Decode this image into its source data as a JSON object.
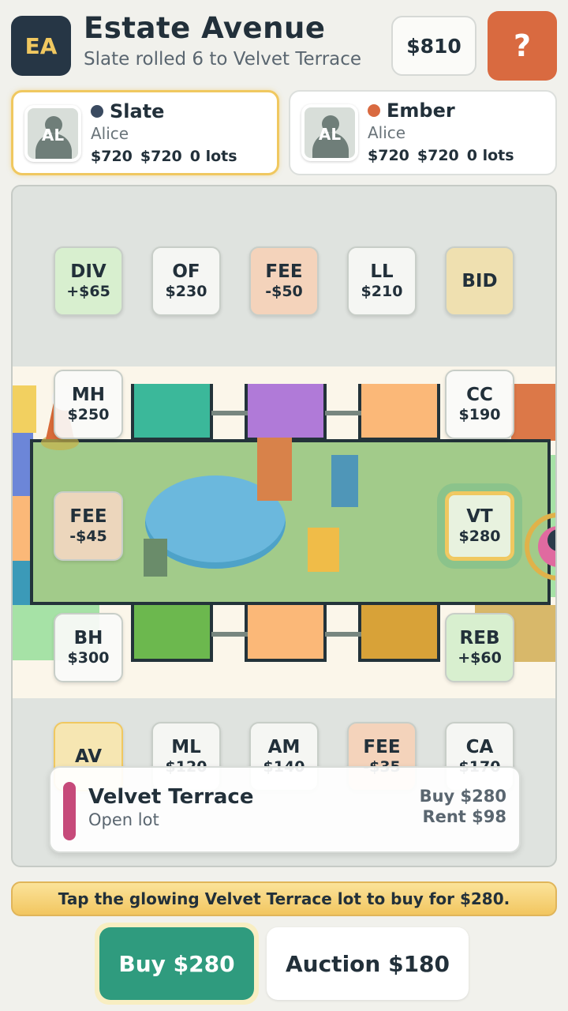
{
  "header": {
    "logo": "EA",
    "title": "Estate Avenue",
    "subtitle": "Slate rolled 6 to Velvet Terrace",
    "cash": "$810",
    "help": "?"
  },
  "players": [
    {
      "name": "Slate",
      "dot_color": "#3a4a60",
      "avatar": "AL",
      "owner": "Alice",
      "cash": "$720",
      "worth": "$720",
      "lots": "0 lots",
      "active": true
    },
    {
      "name": "Ember",
      "dot_color": "#d96a40",
      "avatar": "AL",
      "owner": "Alice",
      "cash": "$720",
      "worth": "$720",
      "lots": "0 lots",
      "active": false
    }
  ],
  "tiles": {
    "top_row": [
      {
        "code": "DIV",
        "val": "+$65",
        "color": "#d8efcf"
      },
      {
        "code": "OF",
        "val": "$230",
        "color": "#f5f6f3"
      },
      {
        "code": "FEE",
        "val": "-$50",
        "color": "#f4d3bb"
      },
      {
        "code": "LL",
        "val": "$210",
        "color": "#f5f6f3"
      },
      {
        "code": "BID",
        "val": "",
        "color": "#efe0b0"
      }
    ],
    "mh": {
      "code": "MH",
      "val": "$250"
    },
    "cc": {
      "code": "CC",
      "val": "$190"
    },
    "fee_left": {
      "code": "FEE",
      "val": "-$45"
    },
    "vt": {
      "code": "VT",
      "val": "$280"
    },
    "bh": {
      "code": "BH",
      "val": "$300"
    },
    "reb": {
      "code": "REB",
      "val": "+$60"
    },
    "bottom_row": [
      {
        "code": "AV",
        "val": "",
        "color": "#f6e6b2"
      },
      {
        "code": "ML",
        "val": "$120",
        "color": "#f5f6f3"
      },
      {
        "code": "AM",
        "val": "$140",
        "color": "#f5f6f3"
      },
      {
        "code": "FEE",
        "val": "-$35",
        "color": "#f4d3bb"
      },
      {
        "code": "CA",
        "val": "$170",
        "color": "#f5f6f3"
      }
    ]
  },
  "info": {
    "name": "Velvet Terrace",
    "status": "Open lot",
    "buy": "Buy $280",
    "rent": "Rent $98",
    "swatch_color": "#c64a7a"
  },
  "hint": "Tap the glowing Velvet Terrace lot to buy for $280.",
  "actions": {
    "buy": "Buy $280",
    "auction": "Auction $180"
  }
}
